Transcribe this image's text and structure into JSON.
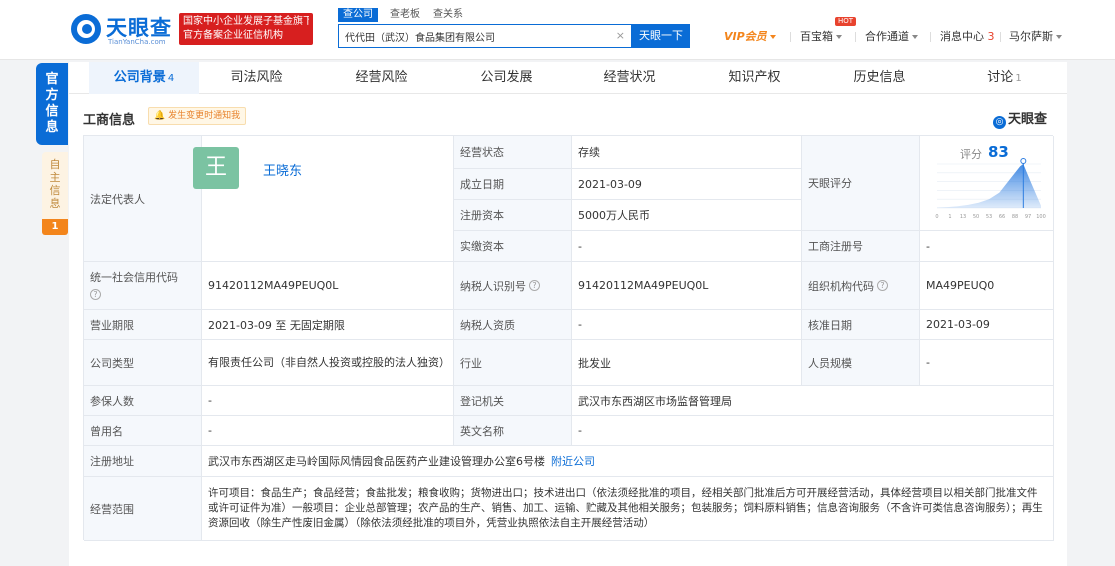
{
  "brand": {
    "name_cn": "天眼查",
    "name_en": "TianYanCha.com"
  },
  "banner": {
    "line1": "国家中小企业发展子基金旗下",
    "line2": "官方备案企业征信机构"
  },
  "search": {
    "tabs": [
      "查公司",
      "查老板",
      "查关系"
    ],
    "value": "代代田（武汉）食品集团有限公司",
    "clear": "×",
    "button": "天眼一下"
  },
  "nav": {
    "vip": "VIP会员",
    "baibaoxiang": "百宝箱",
    "hot": "HOT",
    "cooperation": "合作通道",
    "messages": "消息中心",
    "message_count": "3",
    "user": "马尔萨斯"
  },
  "side": {
    "official": [
      "官",
      "方",
      "信",
      "息"
    ],
    "self": [
      "自",
      "主",
      "信",
      "息"
    ],
    "self_count": "1"
  },
  "tabs": [
    {
      "label": "公司背景",
      "count": "4"
    },
    {
      "label": "司法风险",
      "count": ""
    },
    {
      "label": "经营风险",
      "count": ""
    },
    {
      "label": "公司发展",
      "count": ""
    },
    {
      "label": "经营状况",
      "count": ""
    },
    {
      "label": "知识产权",
      "count": ""
    },
    {
      "label": "历史信息",
      "count": ""
    },
    {
      "label": "讨论",
      "count": "1"
    }
  ],
  "section": {
    "title": "工商信息",
    "notify": "发生变更时通知我",
    "brand_right": "天眼查"
  },
  "info": {
    "legal_rep_label": "法定代表人",
    "legal_rep_avatar": "王",
    "legal_rep_name": "王晓东",
    "status_label": "经营状态",
    "status": "存续",
    "found_label": "成立日期",
    "found": "2021-03-09",
    "reg_cap_label": "注册资本",
    "reg_cap": "5000万人民币",
    "paid_cap_label": "实缴资本",
    "paid_cap": "-",
    "score_label": "天眼评分",
    "score_text": "评分",
    "score": "83",
    "reg_no_label": "工商注册号",
    "reg_no": "-",
    "credit_code_label": "统一社会信用代码",
    "credit_code": "91420112MA49PEUQ0L",
    "tax_id_label": "纳税人识别号",
    "tax_id": "91420112MA49PEUQ0L",
    "org_code_label": "组织机构代码",
    "org_code": "MA49PEUQ0",
    "term_label": "营业期限",
    "term": "2021-03-09  至  无固定期限",
    "tax_qual_label": "纳税人资质",
    "tax_qual": "-",
    "approve_label": "核准日期",
    "approve": "2021-03-09",
    "type_label": "公司类型",
    "type": "有限责任公司（非自然人投资或控股的法人独资）",
    "industry_label": "行业",
    "industry": "批发业",
    "staff_label": "人员规模",
    "staff": "-",
    "insured_label": "参保人数",
    "insured": "-",
    "authority_label": "登记机关",
    "authority": "武汉市东西湖区市场监督管理局",
    "former_label": "曾用名",
    "former": "-",
    "en_name_label": "英文名称",
    "en_name": "-",
    "address_label": "注册地址",
    "address": "武汉市东西湖区走马岭国际风情园食品医药产业建设管理办公室6号楼",
    "nearby": "附近公司",
    "scope_label": "经营范围",
    "scope": "许可项目：食品生产；食品经营；食盐批发；粮食收购；货物进出口；技术进出口（依法须经批准的项目，经相关部门批准后方可开展经营活动，具体经营项目以相关部门批准文件或许可证件为准）一般项目：企业总部管理；农产品的生产、销售、加工、运输、贮藏及其他相关服务；包装服务；饲料原料销售；信息咨询服务（不含许可类信息咨询服务）；再生资源回收（除生产性废旧金属）（除依法须经批准的项目外，凭营业执照依法自主开展经营活动）"
  },
  "chart_data": {
    "type": "area",
    "x": [
      0,
      10,
      20,
      30,
      40,
      50,
      60,
      70,
      80,
      83,
      90,
      100
    ],
    "y": [
      0.01,
      0.02,
      0.04,
      0.07,
      0.12,
      0.2,
      0.35,
      0.65,
      0.95,
      1.0,
      0.6,
      0.05
    ],
    "xticks": [
      "0",
      "1",
      "13",
      "50",
      "53",
      "66",
      "88",
      "97",
      "100"
    ],
    "marker": 83,
    "xlim": [
      0,
      100
    ],
    "color": "#2d7de0"
  }
}
